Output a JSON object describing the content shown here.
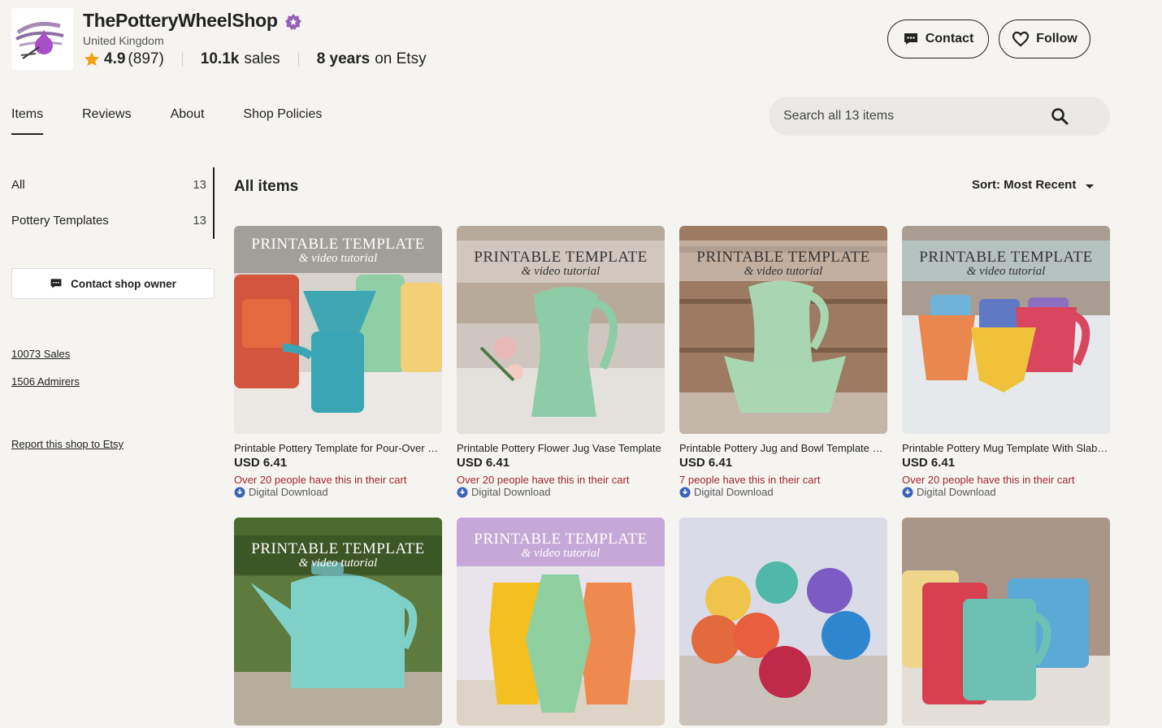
{
  "shop": {
    "name": "ThePotteryWheelShop",
    "location": "United Kingdom",
    "rating": "4.9",
    "rating_count": "(897)",
    "sales_value": "10.1k",
    "sales_label": "sales",
    "years_value": "8 years",
    "years_label": "on Etsy"
  },
  "header": {
    "contact_label": "Contact",
    "follow_label": "Follow"
  },
  "tabs": [
    {
      "label": "Items"
    },
    {
      "label": "Reviews"
    },
    {
      "label": "About"
    },
    {
      "label": "Shop Policies"
    }
  ],
  "search": {
    "placeholder": "Search all 13 items"
  },
  "sidebar": {
    "categories": [
      {
        "label": "All",
        "count": "13"
      },
      {
        "label": "Pottery Templates",
        "count": "13"
      }
    ],
    "contact_owner_label": "Contact shop owner",
    "sales_link": "10073 Sales",
    "admirers_link": "1506 Admirers",
    "report_link": "Report this shop to Etsy"
  },
  "main": {
    "title": "All items",
    "sort_label": "Sort: Most Recent"
  },
  "banner": {
    "line1": "PRINTABLE TEMPLATE",
    "line2": "& video tutorial"
  },
  "listings": [
    {
      "title": "Printable Pottery Template for Pour-Over Coffee Set",
      "price": "USD 6.41",
      "cart": "Over 20 people have this in their cart",
      "tag": "Digital Download"
    },
    {
      "title": "Printable Pottery Flower Jug Vase Template",
      "price": "USD 6.41",
      "cart": "Over 20 people have this in their cart",
      "tag": "Digital Download"
    },
    {
      "title": "Printable Pottery Jug and Bowl Template Set",
      "price": "USD 6.41",
      "cart": "7 people have this in their cart",
      "tag": "Digital Download"
    },
    {
      "title": "Printable Pottery Mug Template With Slab Handle",
      "price": "USD 6.41",
      "cart": "Over 20 people have this in their cart",
      "tag": "Digital Download"
    }
  ],
  "colors": {
    "star": "#f1a10d",
    "verified": "#9560b8",
    "cart_text": "#a3262e",
    "download": "#3a63b8"
  }
}
